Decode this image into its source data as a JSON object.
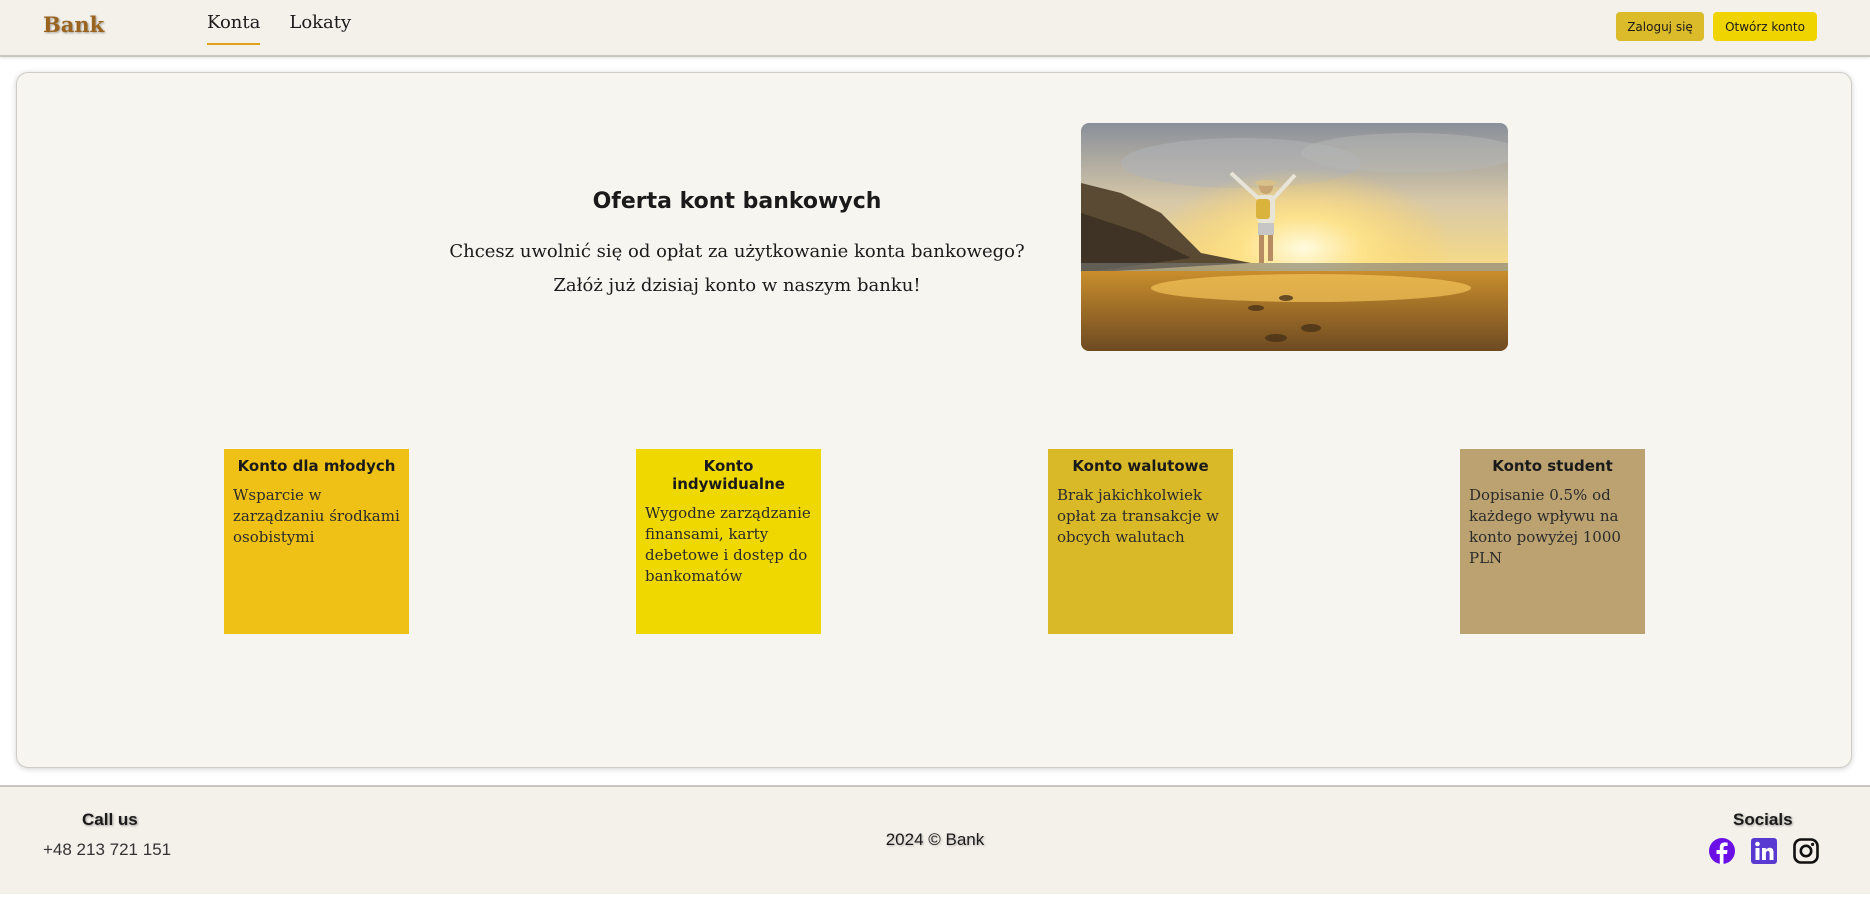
{
  "header": {
    "logo": "Bank",
    "nav": [
      {
        "label": "Konta",
        "active": true
      },
      {
        "label": "Lokaty",
        "active": false
      }
    ],
    "login_label": "Zaloguj się",
    "open_account_label": "Otwórz konto"
  },
  "hero": {
    "title": "Oferta kont bankowych",
    "line1": "Chcesz uwolnić się od opłat za użytkowanie konta bankowego?",
    "line2": "Załóż już dzisiaj konto w naszym banku!"
  },
  "tiles": [
    {
      "title": "Konto dla młodych",
      "desc": "Wsparcie w zarządzaniu środkami osobistymi",
      "color": "#efc116"
    },
    {
      "title": "Konto indywidualne",
      "desc": "Wygodne zarządzanie finansami, karty debetowe i dostęp do bankomatów",
      "color": "#efd700"
    },
    {
      "title": "Konto walutowe",
      "desc": "Brak jakichkolwiek opłat za transakcje w obcych walutach",
      "color": "#d9b928"
    },
    {
      "title": "Konto student",
      "desc": "Dopisanie 0.5% od każdego wpływu na konto powyżej 1000 PLN",
      "color": "#bba270"
    }
  ],
  "footer": {
    "call_title": "Call us",
    "phone": "+48 213 721 151",
    "copyright": "2024 © Bank",
    "socials_title": "Socials",
    "icons": [
      "facebook-icon",
      "linkedin-icon",
      "instagram-icon"
    ]
  },
  "colors": {
    "accent": "#e0a21c",
    "logo": "#9a6420",
    "login_button": "#dcbb2a",
    "open_button": "#f0d400"
  }
}
